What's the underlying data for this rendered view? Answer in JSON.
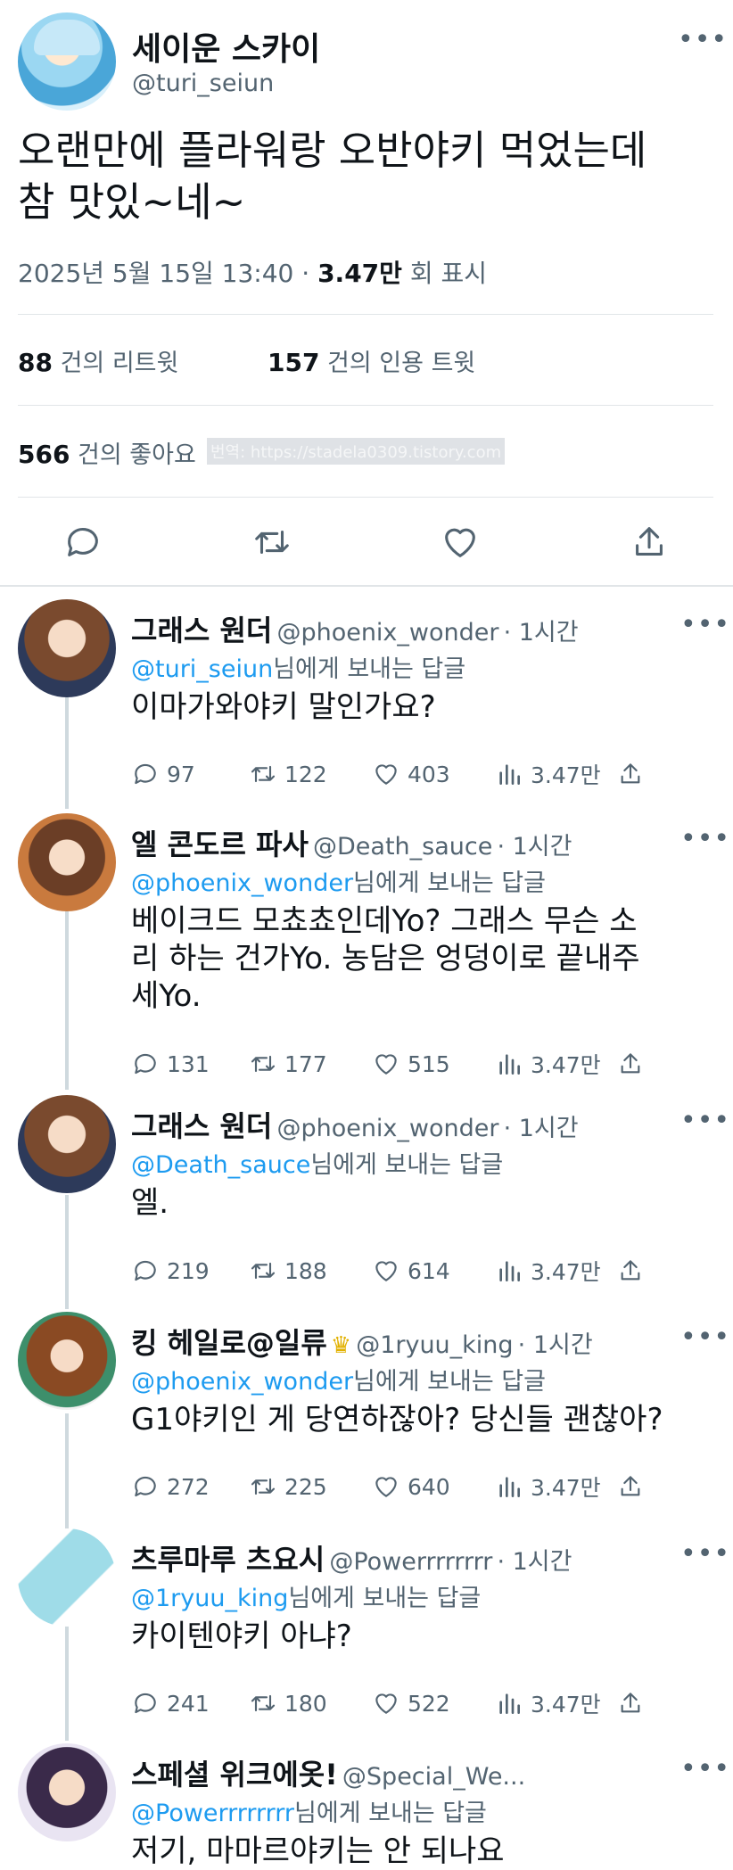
{
  "main": {
    "name": "세이운 스카이",
    "handle": "@turi_seiun",
    "text": "오랜만에 플라워랑 오반야키 먹었는데\n참 맛있~네~",
    "timestamp": "2025년 5월 15일  13:40",
    "dot": " · ",
    "views": "3.47만",
    "views_label": " 회 표시",
    "retweets_count": "88",
    "retweets_label": "건의 리트윗",
    "quotes_count": "157",
    "quotes_label": "건의 인용 트윗",
    "likes_count": "566",
    "likes_label": "건의 좋아요",
    "watermark": "번역: https://stadela0309.tistory.com"
  },
  "replies": [
    {
      "name": "그래스 원더",
      "handle": "@phoenix_wonder",
      "time": "· 1시간",
      "to": "@turi_seiun",
      "to_suffix": "님에게 보내는 답글",
      "text": "이마가와야키 말인가요?",
      "reply": "97",
      "retweet": "122",
      "like": "403",
      "views": "3.47만"
    },
    {
      "name": "엘 콘도르 파사",
      "handle": "@Death_sauce",
      "time": "· 1시간",
      "to": "@phoenix_wonder",
      "to_suffix": "님에게 보내는 답글",
      "text": "베이크드 모쵸쵸인데Yo? 그래스 무슨 소\n리 하는 건가Yo. 농담은 엉덩이로 끝내주\n세Yo.",
      "reply": "131",
      "retweet": "177",
      "like": "515",
      "views": "3.47만"
    },
    {
      "name": "그래스 원더",
      "handle": "@phoenix_wonder",
      "time": "· 1시간",
      "to": "@Death_sauce",
      "to_suffix": "님에게 보내는 답글",
      "text": "엘.",
      "reply": "219",
      "retweet": "188",
      "like": "614",
      "views": "3.47만"
    },
    {
      "name": "킹 헤일로@일류",
      "handle": "@1ryuu_king",
      "time": "· 1시간",
      "to": "@phoenix_wonder",
      "to_suffix": "님에게 보내는 답글",
      "text": "G1야키인 게 당연하잖아? 당신들 괜찮아?",
      "reply": "272",
      "retweet": "225",
      "like": "640",
      "views": "3.47만"
    },
    {
      "name": "츠루마루 츠요시",
      "handle": "@Powerrrrrrrr",
      "time": "· 1시간",
      "to": "@1ryuu_king",
      "to_suffix": "님에게 보내는 답글",
      "text": "카이텐야키 아냐?",
      "reply": "241",
      "retweet": "180",
      "like": "522",
      "views": "3.47만"
    },
    {
      "name": "스페셜 위크에옷!",
      "handle": "@Special_We...",
      "time": "",
      "to": "@Powerrrrrrrr",
      "to_suffix": "님에게 보내는 답글",
      "text": "저기, 마마르야키는 안 되나요",
      "reply": "",
      "retweet": "",
      "like": "",
      "views": ""
    }
  ],
  "more_glyph": "•••",
  "crown_glyph": "♛",
  "icons": [
    "more-dots-icon",
    "reply-icon",
    "retweet-icon",
    "like-icon",
    "share-icon",
    "views-icon",
    "crown-icon"
  ],
  "colors": {
    "link": "#1d9bf0",
    "secondary": "#536471",
    "text": "#0f1419",
    "divider": "#e1e5e8"
  }
}
